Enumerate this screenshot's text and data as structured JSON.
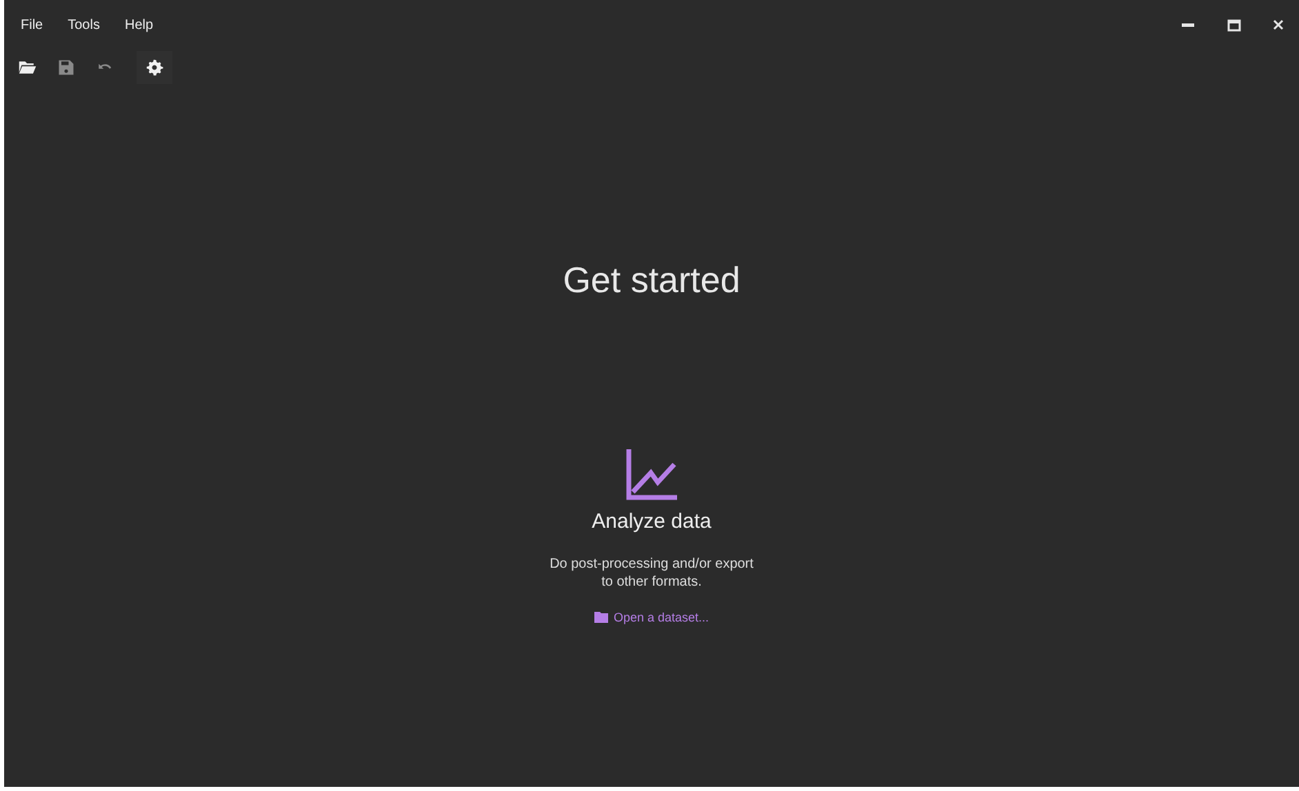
{
  "menu_bar": [
    {
      "label": "File"
    },
    {
      "label": "Tools"
    },
    {
      "label": "Help"
    }
  ],
  "toolbar": [
    {
      "kind": "open",
      "disabled": false
    },
    {
      "kind": "save",
      "disabled": true
    },
    {
      "kind": "undo",
      "disabled": true
    },
    {
      "kind": "settings",
      "disabled": false
    }
  ],
  "heading": "Get started",
  "card": {
    "title": "Analyze data",
    "description": "Do post-processing and/or export to other formats.",
    "link": "Open a dataset..."
  }
}
